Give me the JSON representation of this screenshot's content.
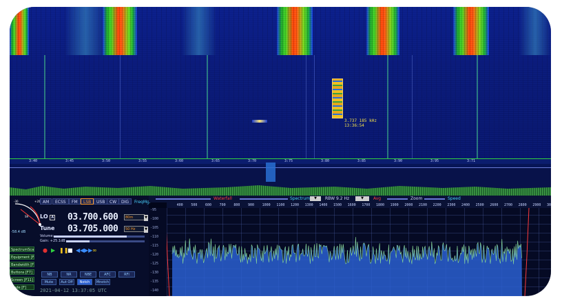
{
  "waterfall": {
    "ruler_ticks": [
      "3:40",
      "3:45",
      "3:50",
      "3:55",
      "3:60",
      "3:65",
      "3:70",
      "3:75",
      "3:80",
      "3:85",
      "3:90",
      "3:95",
      "3:71"
    ],
    "cursor_readout": [
      "3.737 185 kHz",
      "13:36:54"
    ]
  },
  "modes": [
    {
      "label": "AM",
      "active": false
    },
    {
      "label": "ECSS",
      "active": false
    },
    {
      "label": "FM",
      "active": false
    },
    {
      "label": "LSB",
      "active": true
    },
    {
      "label": "USB",
      "active": false
    },
    {
      "label": "CW",
      "active": false
    },
    {
      "label": "DIG",
      "active": false
    },
    {
      "label": "FreqMgr",
      "active": false,
      "link": true
    }
  ],
  "lo": {
    "label": "LO",
    "badge": "A",
    "value": "03.700.600",
    "step": "80m"
  },
  "tune": {
    "label": "Tune",
    "value": "03.705.000",
    "step": "50 Hz"
  },
  "volume": {
    "label": "Volume:",
    "level": 0.8
  },
  "gain": {
    "label": "Gain: +25.1dB",
    "level": 0.3
  },
  "smeter": {
    "value": "-58.4 dB",
    "scale": [
      "-30",
      "S9",
      "+20"
    ]
  },
  "side_buttons": [
    "SpectrumScale [S]",
    "Equipment [F5]",
    "Bandwidth [F6]",
    "Buttons [F7]",
    "Screen [F11]",
    "Mode [F]"
  ],
  "transport": [
    "●",
    "▶",
    "❚❚",
    "■",
    "◀◀",
    "▶▶",
    "∞"
  ],
  "dsp_row1": [
    "NB",
    "NR",
    "NBE",
    "AFC",
    "RFI"
  ],
  "dsp_row2": [
    "Mute",
    "Aut Off",
    "Notch",
    "Mnotch"
  ],
  "clock": "2021-04-12  13:37:05 UTC",
  "toolbar": {
    "waterfall": "Waterfall",
    "spectrum": "Spectrum",
    "rbw_label": "RBW",
    "rbw_value": "9.2 Hz",
    "avg": "Avg",
    "zoom": "Zoom",
    "speed": "Speed"
  },
  "spectrum": {
    "freq_ticks": [
      "400",
      "500",
      "600",
      "700",
      "800",
      "900",
      "1000",
      "1100",
      "1200",
      "1300",
      "1400",
      "1500",
      "1600",
      "1700",
      "1800",
      "1900",
      "2000",
      "2100",
      "2200",
      "2300",
      "2400",
      "2500",
      "2600",
      "2700",
      "2800",
      "2900",
      "3000"
    ],
    "db_ticks": [
      "-95",
      "-100",
      "-105",
      "-110",
      "-115",
      "-120",
      "-125",
      "-130",
      "-135",
      "-140"
    ],
    "passband_low": 300,
    "passband_high": 2700
  }
}
